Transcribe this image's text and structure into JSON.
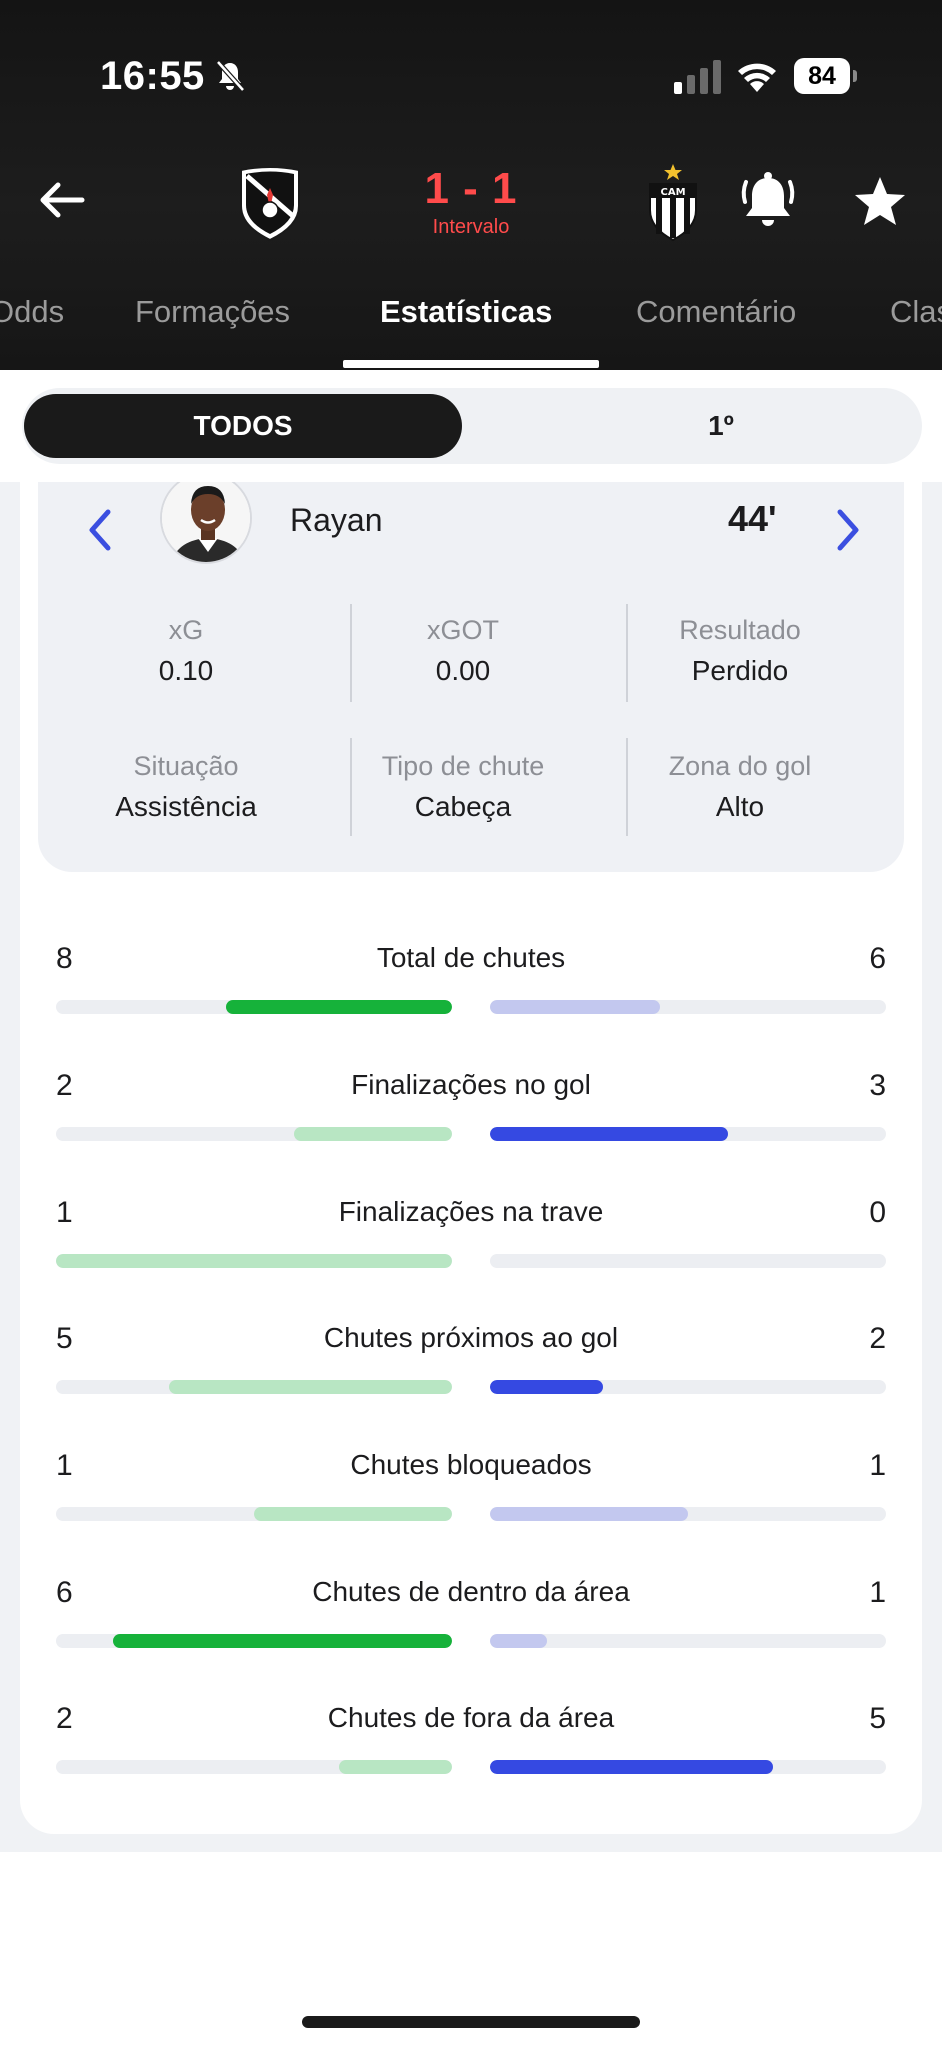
{
  "status_bar": {
    "time": "16:55",
    "battery": "84"
  },
  "match": {
    "score": "1 - 1",
    "period": "Intervalo"
  },
  "tabs": [
    {
      "label": "Odds"
    },
    {
      "label": "Formações"
    },
    {
      "label": "Estatísticas"
    },
    {
      "label": "Comentário"
    },
    {
      "label": "Class"
    }
  ],
  "filter": {
    "all_label": "TODOS",
    "first_half_label": "1º"
  },
  "shot": {
    "player": "Rayan",
    "minute": "44'",
    "metrics": [
      {
        "label": "xG",
        "value": "0.10"
      },
      {
        "label": "xGOT",
        "value": "0.00"
      },
      {
        "label": "Resultado",
        "value": "Perdido"
      },
      {
        "label": "Situação",
        "value": "Assistência"
      },
      {
        "label": "Tipo de chute",
        "value": "Cabeça"
      },
      {
        "label": "Zona do gol",
        "value": "Alto"
      }
    ]
  },
  "colors": {
    "home_strong": "#16b23a",
    "home_light": "#b8e6c3",
    "away_strong": "#3549e2",
    "away_light": "#c3c8ef",
    "score_red": "#ff4b4b"
  },
  "stats": [
    {
      "label": "Total de chutes",
      "home": "8",
      "away": "6",
      "leader": "home"
    },
    {
      "label": "Finalizações no gol",
      "home": "2",
      "away": "3",
      "leader": "away"
    },
    {
      "label": "Finalizações na trave",
      "home": "1",
      "away": "0",
      "leader": "home_light"
    },
    {
      "label": "Chutes próximos ao gol",
      "home": "5",
      "away": "2",
      "leader": "home_light_away_strong"
    },
    {
      "label": "Chutes bloqueados",
      "home": "1",
      "away": "1",
      "leader": "tie"
    },
    {
      "label": "Chutes de dentro da área",
      "home": "6",
      "away": "1",
      "leader": "home"
    },
    {
      "label": "Chutes de fora da área",
      "home": "2",
      "away": "5",
      "leader": "away"
    }
  ]
}
